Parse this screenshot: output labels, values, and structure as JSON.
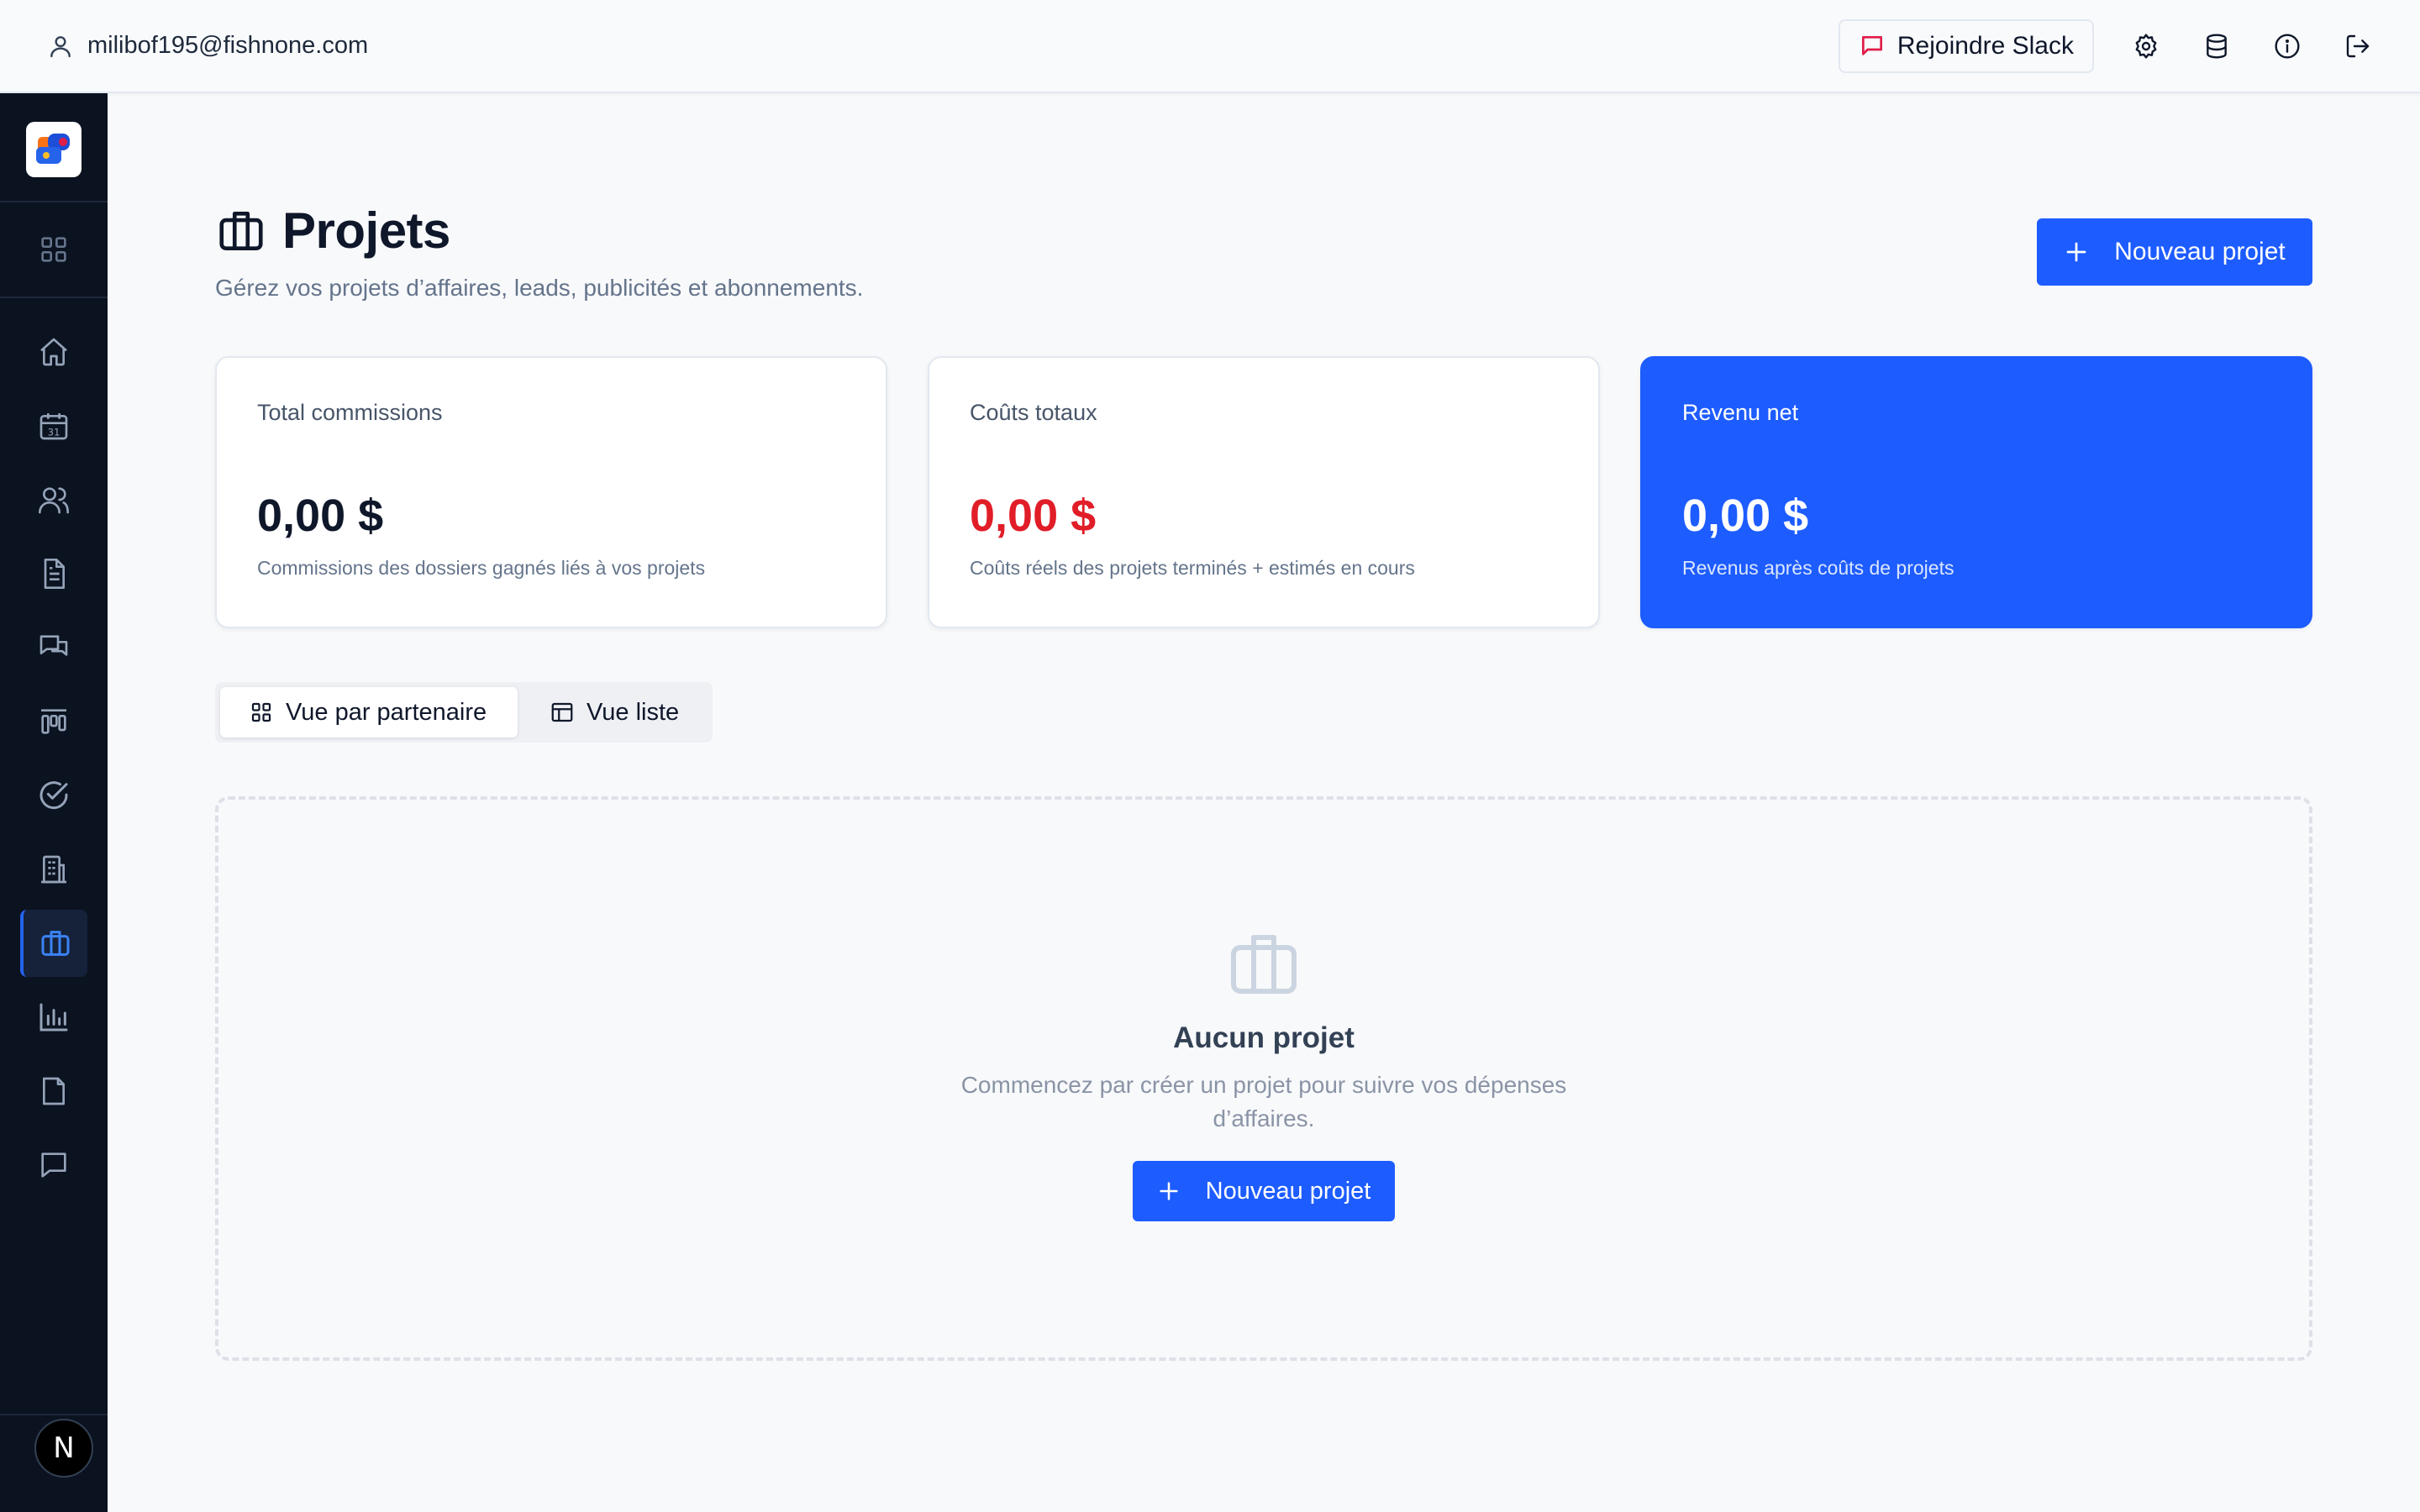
{
  "topbar": {
    "user_email": "milibof195@fishnone.com",
    "slack_label": "Rejoindre Slack",
    "icons": [
      "settings-icon",
      "database-icon",
      "info-icon",
      "logout-icon"
    ]
  },
  "sidebar": {
    "items": [
      {
        "icon": "grid-icon"
      },
      {
        "icon": "home-icon"
      },
      {
        "icon": "calendar-icon"
      },
      {
        "icon": "users-icon"
      },
      {
        "icon": "document-icon"
      },
      {
        "icon": "messages-icon"
      },
      {
        "icon": "kanban-icon"
      },
      {
        "icon": "check-circle-icon"
      },
      {
        "icon": "building-icon"
      },
      {
        "icon": "briefcase-icon",
        "active": true
      },
      {
        "icon": "bar-chart-icon"
      },
      {
        "icon": "file-icon"
      },
      {
        "icon": "chat-icon"
      }
    ],
    "avatar_letter": "N"
  },
  "page": {
    "title": "Projets",
    "subtitle": "Gérez vos projets d’affaires, leads, publicités et abonnements.",
    "new_button": "Nouveau projet"
  },
  "cards": [
    {
      "label": "Total commissions",
      "value": "0,00 $",
      "desc": "Commissions des dossiers gagnés liés à vos projets"
    },
    {
      "label": "Coûts totaux",
      "value": "0,00 $",
      "desc": "Coûts réels des projets terminés + estimés en cours"
    },
    {
      "label": "Revenu net",
      "value": "0,00 $",
      "desc": "Revenus après coûts de projets"
    }
  ],
  "view_toggle": {
    "partner": "Vue par partenaire",
    "list": "Vue liste",
    "active": "partner"
  },
  "empty_state": {
    "title": "Aucun projet",
    "text": "Commencez par créer un projet pour suivre vos dépenses d’affaires.",
    "button": "Nouveau projet"
  },
  "colors": {
    "accent": "#1d5cff",
    "sidebar_bg": "#0b1220",
    "negative": "#e11d28",
    "slack_icon": "#e11d48"
  }
}
